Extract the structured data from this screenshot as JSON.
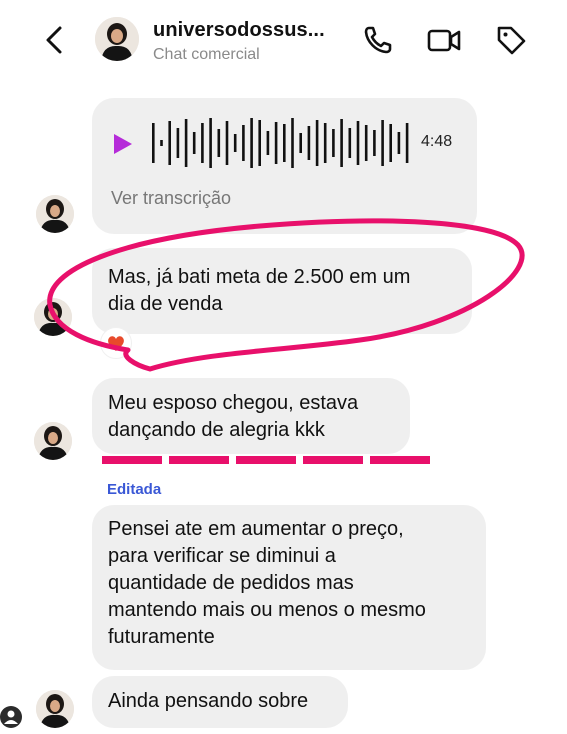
{
  "header": {
    "back_icon": "chevron-left-icon",
    "contact_name": "universodossus...",
    "subtitle": "Chat comercial",
    "icons": [
      "phone-icon",
      "video-camera-icon",
      "tag-icon"
    ]
  },
  "messages": {
    "audio": {
      "duration": "4:48",
      "transcript_link": "Ver transcrição",
      "play_color": "#b52bd9"
    },
    "msg1": {
      "text": "Mas, já bati meta de 2.500 em um\ndia de venda",
      "reaction": "heart-emoji"
    },
    "msg2": {
      "text": "Meu esposo chegou, estava\ndançando de alegria kkk",
      "edited_label": "Editada"
    },
    "msg3": {
      "text": "Pensei ate em aumentar o preço,\npara verificar se diminui a\nquantidade de pedidos mas\nmantendo mais ou menos o mesmo\nfuturamente"
    },
    "msg4": {
      "text": "Ainda pensando sobre"
    }
  },
  "colors": {
    "annotation_pink": "#e8106b",
    "bubble_grey": "#efefef",
    "edited_blue": "#3a58d6"
  }
}
